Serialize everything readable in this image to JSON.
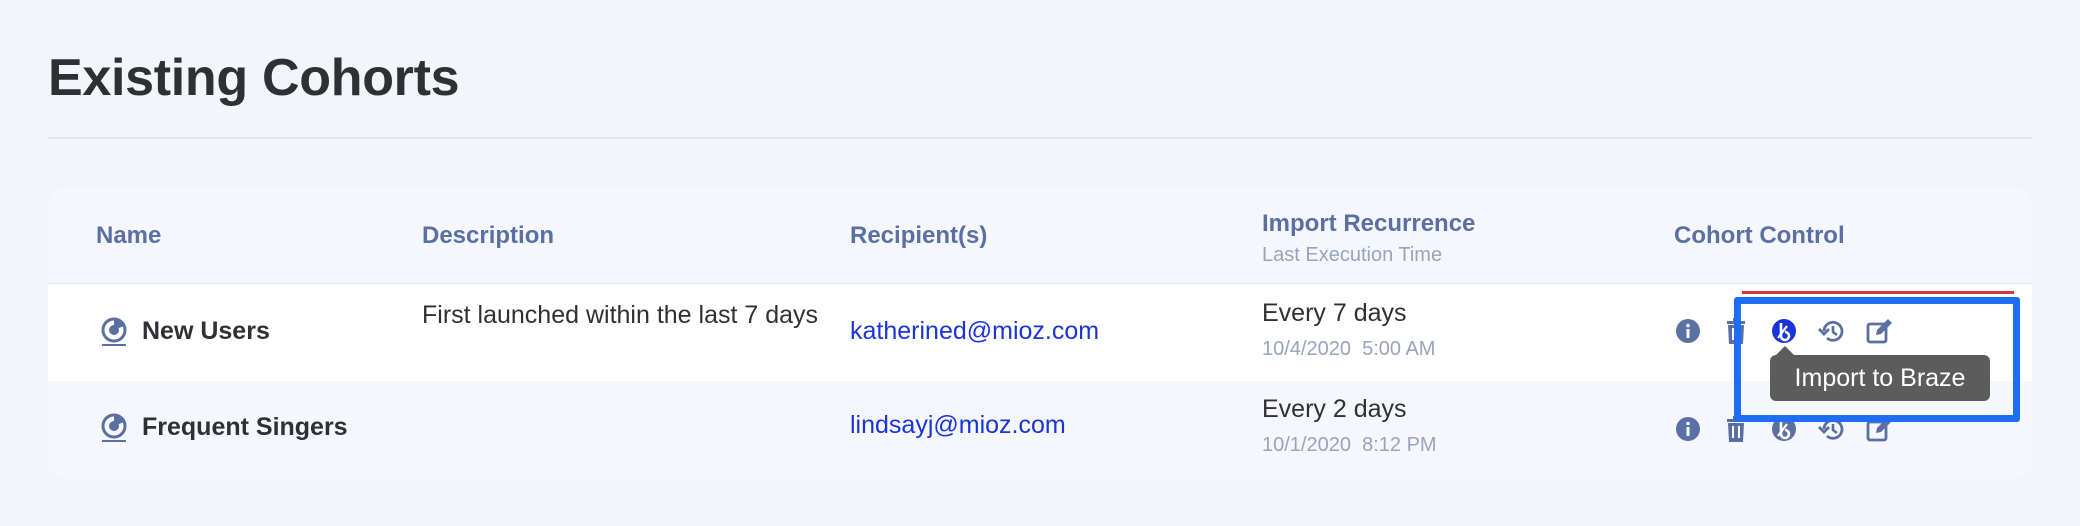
{
  "page": {
    "title": "Existing Cohorts"
  },
  "table": {
    "headers": {
      "name": "Name",
      "description": "Description",
      "recipients": "Recipient(s)",
      "import_recurrence": "Import Recurrence",
      "import_recurrence_sub": "Last Execution Time",
      "cohort_control": "Cohort Control"
    },
    "rows": [
      {
        "name": "New Users",
        "description": "First launched within the last 7 days",
        "recipient": "katherined@mioz.com",
        "recurrence": "Every 7 days",
        "last_execution": "10/4/2020  5:00 AM"
      },
      {
        "name": "Frequent Singers",
        "description": "",
        "recipient": "lindsayj@mioz.com",
        "recurrence": "Every 2 days",
        "last_execution": "10/1/2020  8:12 PM"
      }
    ]
  },
  "tooltip": {
    "text": "Import to Braze"
  },
  "icons": {
    "cohort": "pie-chart-icon",
    "info": "info-icon",
    "delete": "trash-icon",
    "braze": "braze-icon",
    "history": "history-icon",
    "edit": "edit-icon"
  },
  "colors": {
    "background": "#f3f5fb",
    "header_text": "#5a6fa3",
    "link": "#1a34d9",
    "icon": "#5a6fa3",
    "braze_active": "#1a34d9",
    "highlight": "#1e6df5",
    "tooltip_bg": "#5c5c5c"
  }
}
